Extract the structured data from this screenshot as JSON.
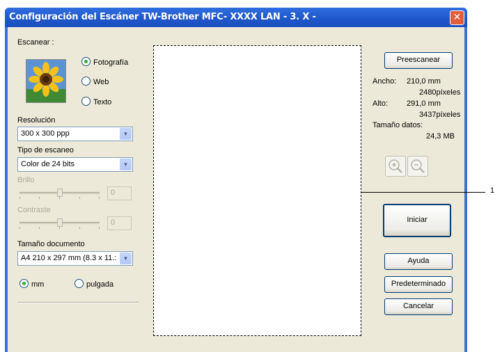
{
  "window": {
    "title": "Configuración del Escáner TW-Brother MFC- XXXX    LAN - 3. X -"
  },
  "icons": {
    "close": "close-icon",
    "zoom_in": "zoom-in-icon",
    "zoom_out": "zoom-out-icon",
    "photo": "sunflower-photo-icon"
  },
  "scan": {
    "label": "Escanear :",
    "options": [
      "Fotografía",
      "Web",
      "Texto"
    ],
    "selected": "Fotografía"
  },
  "resolution": {
    "label": "Resolución",
    "value": "300 x 300 ppp"
  },
  "scan_type": {
    "label": "Tipo de escaneo",
    "value": "Color de 24 bits"
  },
  "brightness": {
    "label": "Brillo",
    "value": "0"
  },
  "contrast": {
    "label": "Contraste",
    "value": "0"
  },
  "doc_size": {
    "label": "Tamaño documento",
    "value": "A4 210 x 297 mm (8.3 x 11.:"
  },
  "units": {
    "options": [
      "mm",
      "pulgada"
    ],
    "selected": "mm"
  },
  "buttons": {
    "prescan": "Preescanear",
    "start": "Iniciar",
    "help": "Ayuda",
    "default": "Predeterminado",
    "cancel": "Cancelar"
  },
  "info": {
    "width_label": "Ancho:",
    "width_mm": "210,0 mm",
    "width_px": "2480píxeles",
    "height_label": "Alto:",
    "height_mm": "291,0 mm",
    "height_px": "3437píxeles",
    "size_label": "Tamaño datos:",
    "size_value": "24,3 MB"
  },
  "callout": {
    "label": "1"
  },
  "colors": {
    "titlebar": "#1f56c8",
    "face": "#ece9d8",
    "accent_radio": "#2ba82b",
    "close": "#e35d3c"
  }
}
